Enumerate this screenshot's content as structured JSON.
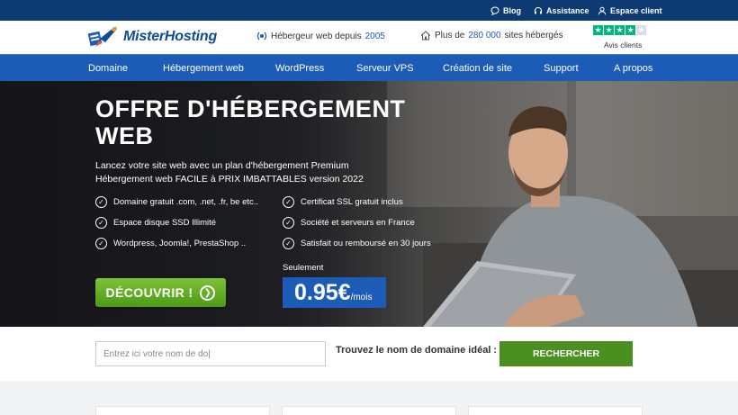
{
  "topbar": {
    "links": [
      {
        "label": "Blog",
        "icon": "chat-icon"
      },
      {
        "label": "Assistance",
        "icon": "headset-icon"
      },
      {
        "label": "Espace client",
        "icon": "user-icon"
      }
    ]
  },
  "header": {
    "logo_text": "MisterHosting",
    "info1_prefix": "Hébergeur web depuis",
    "info1_year": "2005",
    "info2_prefix": "Plus de",
    "info2_count": "280 000",
    "info2_suffix": "sites hébergés",
    "rating_stars": 4,
    "rating_label": "Avis clients"
  },
  "nav": {
    "items": [
      "Domaine",
      "Hébergement web",
      "WordPress",
      "Serveur VPS",
      "Création de site",
      "Support",
      "A propos"
    ]
  },
  "hero": {
    "title": "OFFRE D'HÉBERGEMENT WEB",
    "subtitle": "Lancez votre site web avec un plan d'hébergement Premium Hébergement web FACILE à PRIX IMBATTABLES version 2022",
    "features": [
      "Domaine gratuit .com, .net, .fr, be etc..",
      "Espace disque SSD Illimité",
      "Wordpress, Joomla!, PrestaShop ..",
      "Certificat SSL gratuit inclus",
      "Société et serveurs en France",
      "Satisfait ou remboursé en 30 jours"
    ],
    "cta_label": "DÉCOUVRIR !",
    "price_prefix": "Seulement",
    "price_amount": "0.95€",
    "price_unit": "/mois"
  },
  "domain_search": {
    "placeholder": "Entrez ici votre nom de do|",
    "label": "Trouvez le nom de domaine idéal :",
    "button_label": "RECHERCHER"
  },
  "colors": {
    "topbar": "#0d3a73",
    "nav": "#1d5cb6",
    "cta_green": "#5ea823",
    "search_green": "#4a8f1f",
    "trustpilot": "#00b67a"
  }
}
